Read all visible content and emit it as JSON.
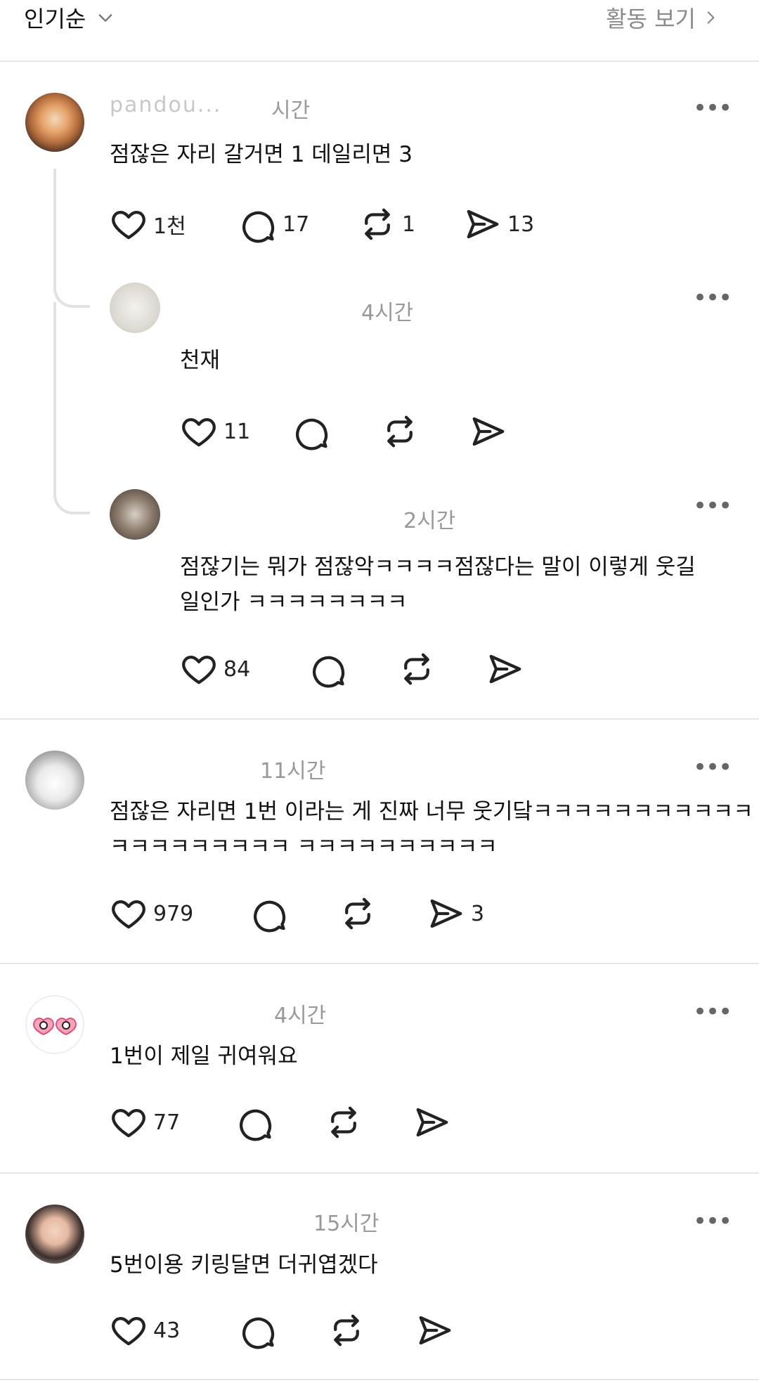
{
  "header": {
    "sort_label": "인기순",
    "activity_label": "활동 보기"
  },
  "comments": [
    {
      "username": "pandou...",
      "time": "시간",
      "text": "점잖은 자리 갈거면 1 데일리면 3",
      "likes": "1천",
      "replies": "17",
      "reposts": "1",
      "shares": "13"
    },
    {
      "username": "",
      "time": "4시간",
      "text": "천재",
      "likes": "11"
    },
    {
      "username": "",
      "time": "2시간",
      "text_line1": "점잖기는 뭐가 점잖악ㅋㅋㅋㅋ점잖다는 말이 이렇게 웃길",
      "text_line2": "일인가 ㅋㅋㅋㅋㅋㅋㅋㅋ",
      "likes": "84"
    },
    {
      "username": "",
      "time": "11시간",
      "text_line1": "점잖은 자리면 1번 이라는 게 진짜 너무 웃기닼ㅋㅋㅋㅋㅋㅋㅋㅋㅋㅋㅋㅋ",
      "text_line2": "ㅋㅋㅋㅋㅋㅋㅋㅋㅋ ㅋㅋㅋㅋㅋㅋㅋㅋㅋㅋ",
      "likes": "979",
      "shares": "3"
    },
    {
      "username": "",
      "time": "4시간",
      "text": "1번이 제일 귀여워요",
      "likes": "77"
    },
    {
      "username": "",
      "time": "15시간",
      "text": "5번이용 키링달면 더귀엽겠다",
      "likes": "43"
    }
  ],
  "colors": {
    "text": "#111111",
    "muted": "#999999",
    "divider": "#e6e6e6"
  }
}
